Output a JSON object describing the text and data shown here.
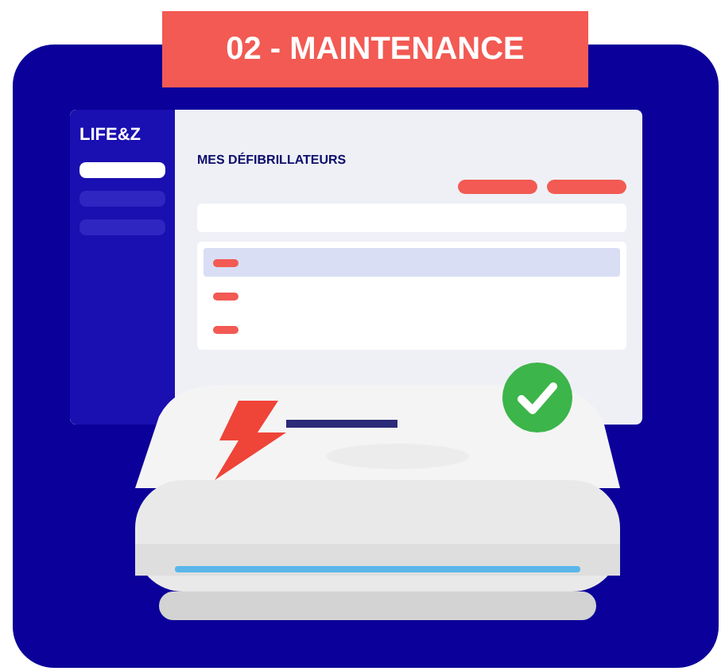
{
  "badge": {
    "text": "02 - MAINTENANCE"
  },
  "mockup": {
    "logo": "LIFE&Z",
    "sidebar": [
      {
        "selected": true
      },
      {
        "selected": false
      },
      {
        "selected": false
      }
    ],
    "heading": "MES DÉFIBRILLATEURS",
    "rows": [
      {
        "selected": true
      },
      {
        "selected": false
      },
      {
        "selected": false
      }
    ]
  }
}
